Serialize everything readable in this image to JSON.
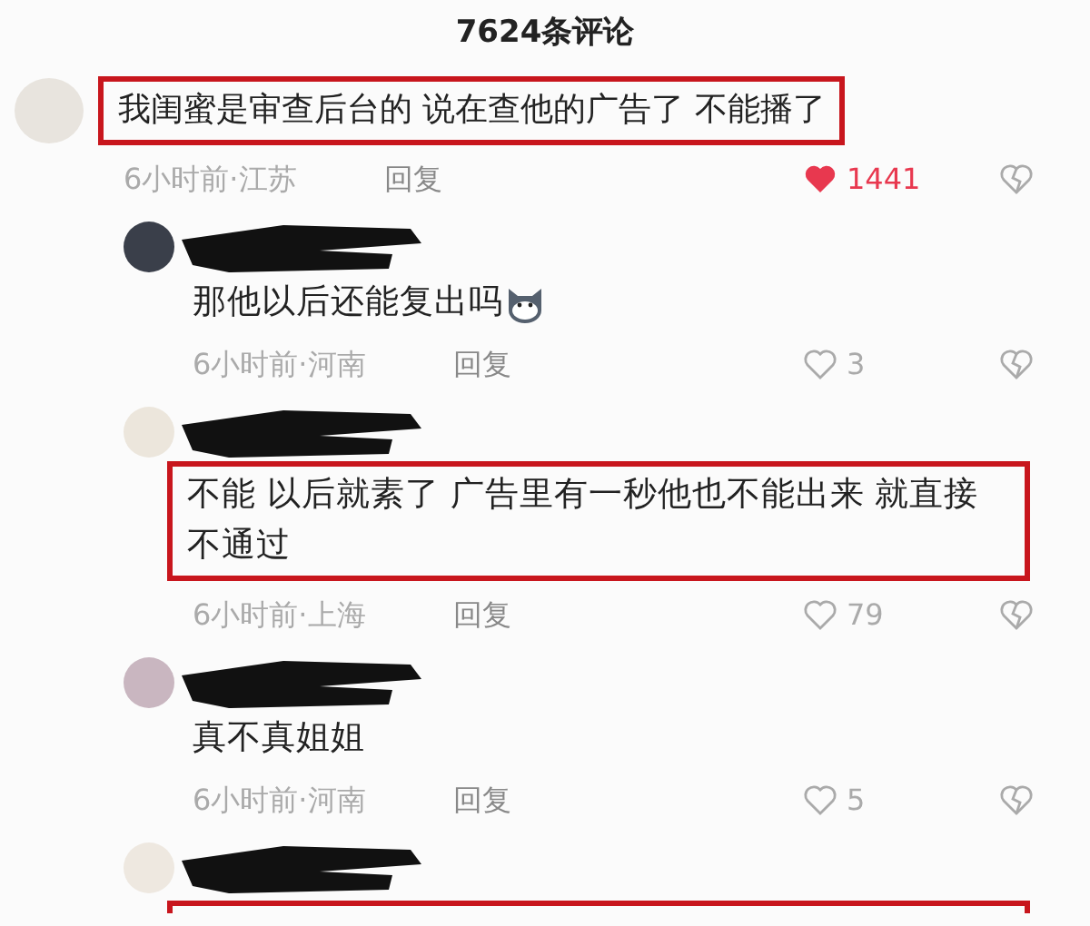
{
  "title": "7624条评论",
  "comment": {
    "text": "我闺蜜是审查后台的 说在查他的广告了 不能播了",
    "highlighted": true,
    "time_place": "6小时前·江苏",
    "reply": "回复",
    "likes": "1441",
    "liked": true,
    "replies": [
      {
        "text": "那他以后还能复出吗",
        "highlighted": false,
        "has_emoji": true,
        "time_place": "6小时前·河南",
        "reply": "回复",
        "likes": "3",
        "liked": false
      },
      {
        "text": "不能 以后就素了 广告里有一秒他也不能出来 就直接不通过",
        "highlighted": true,
        "has_emoji": false,
        "time_place": "6小时前·上海",
        "reply": "回复",
        "likes": "79",
        "liked": false
      },
      {
        "text": "真不真姐姐",
        "highlighted": false,
        "has_emoji": false,
        "time_place": "6小时前·河南",
        "reply": "回复",
        "likes": "5",
        "liked": false
      },
      {
        "highlighted": true
      }
    ]
  }
}
